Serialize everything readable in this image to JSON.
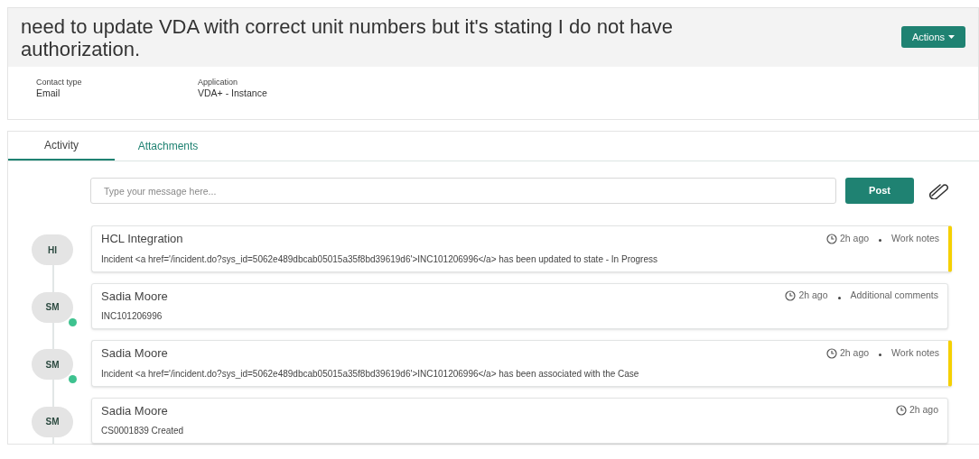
{
  "header": {
    "title": "need to update VDA with correct unit numbers but it's stating I do not have authorization.",
    "action_button": "Actions"
  },
  "fields": [
    {
      "label": "Contact type",
      "value": "Email"
    },
    {
      "label": "Application",
      "value": "VDA+ - Instance"
    }
  ],
  "tabs": [
    {
      "label": "Activity",
      "selected": true
    },
    {
      "label": "Attachments",
      "selected": false
    }
  ],
  "composer": {
    "placeholder": "Type your message here...",
    "button": "Post"
  },
  "entries": [
    {
      "initials": "HI",
      "online": false,
      "author": "HCL Integration",
      "time": "2h ago",
      "type": "Work notes",
      "flagged": true,
      "body": "Incident <a href='/incident.do?sys_id=5062e489dbcab05015a35f8bd39619d6'>INC101206996</a> has been updated to state - In Progress"
    },
    {
      "initials": "SM",
      "online": true,
      "author": "Sadia Moore",
      "time": "2h ago",
      "type": "Additional comments",
      "flagged": false,
      "body": "INC101206996"
    },
    {
      "initials": "SM",
      "online": true,
      "author": "Sadia Moore",
      "time": "2h ago",
      "type": "Work notes",
      "flagged": true,
      "body": "Incident <a href='/incident.do?sys_id=5062e489dbcab05015a35f8bd39619d6'>INC101206996</a> has been associated with the Case"
    },
    {
      "initials": "SM",
      "online": false,
      "author": "Sadia Moore",
      "time": "2h ago",
      "flagged": false,
      "body": "CS0001839 Created"
    }
  ]
}
